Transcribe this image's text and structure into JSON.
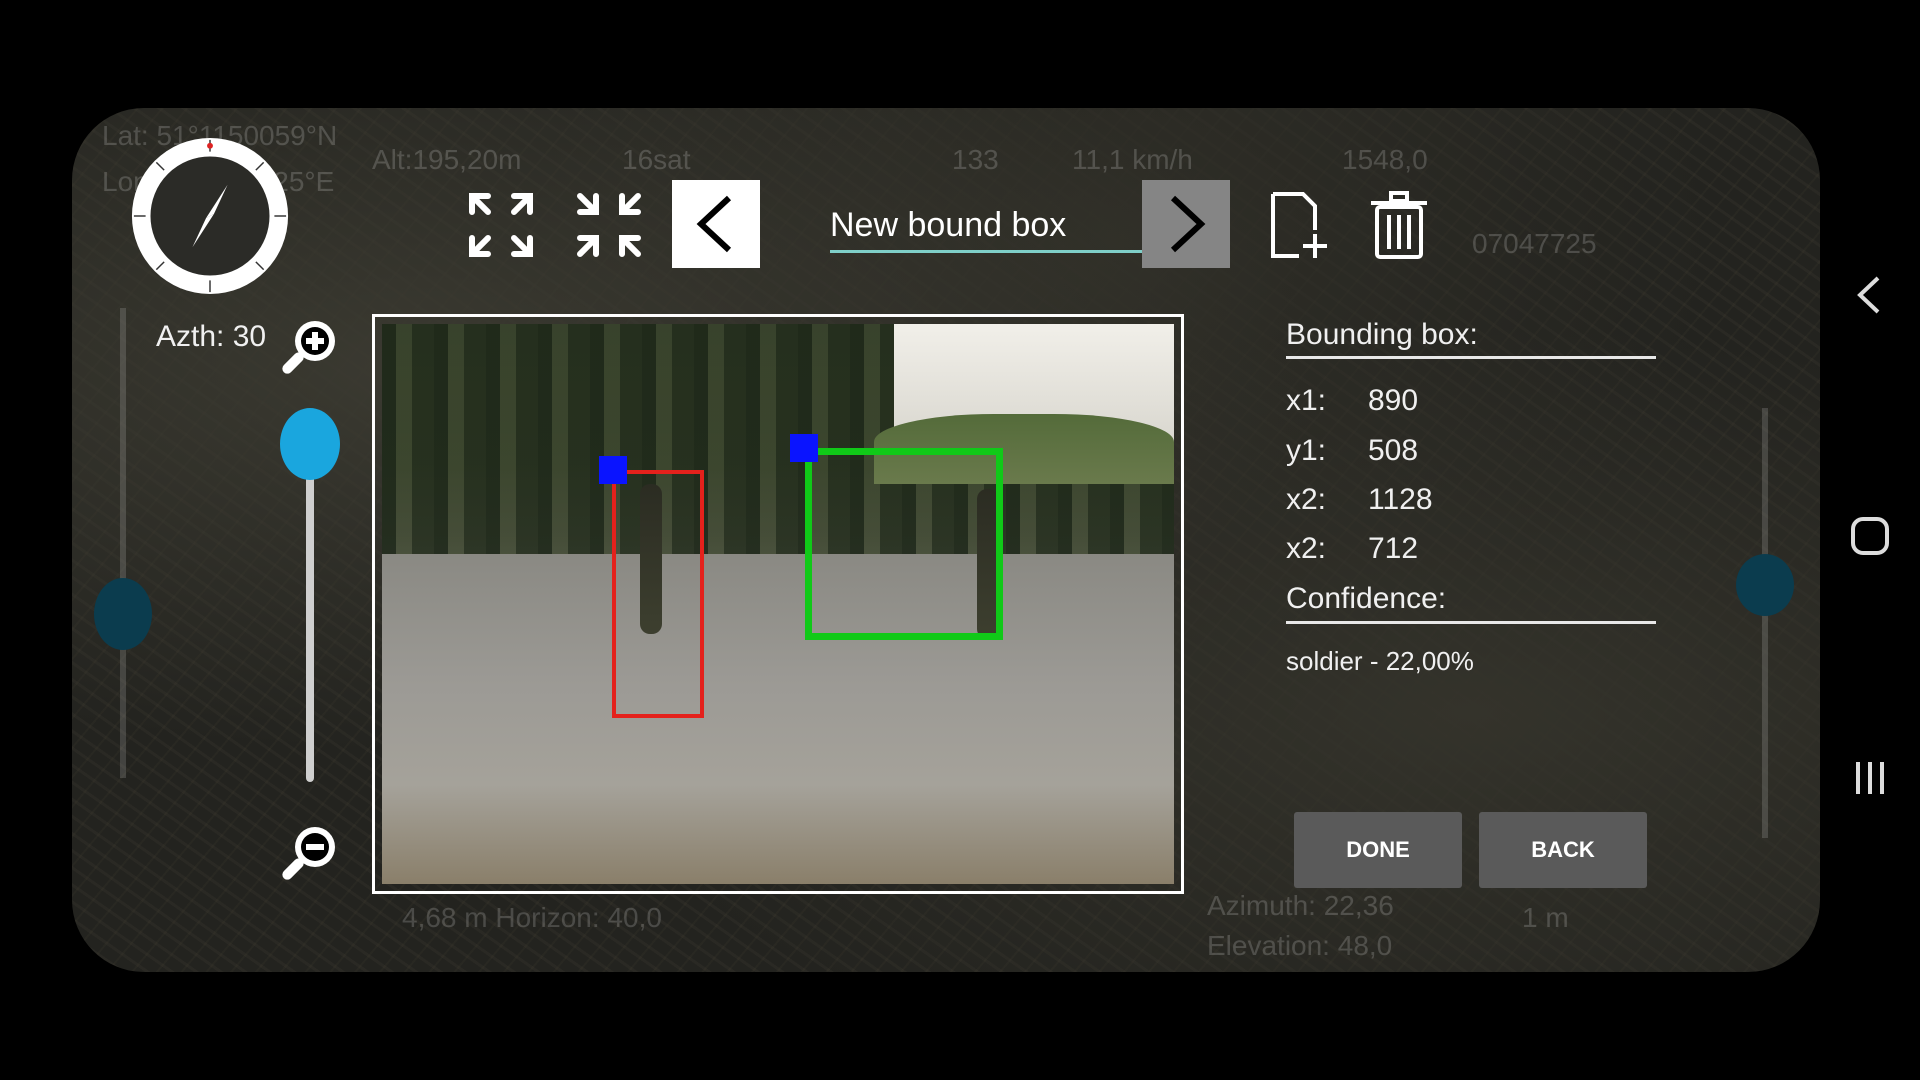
{
  "overlay": {
    "lat": "Lat: 51°1150059°N",
    "lon": "Lon:15.3935725°E",
    "alt": "Alt:195,20m",
    "sat": "16sat",
    "heading": "133",
    "speed": "11,1 km/h",
    "code": "1548,0",
    "coord": "07047725",
    "distance": "4,68 m Horizon: 40,0",
    "azimuth": "Azimuth: 22,36",
    "elevation": "Elevation: 48,0",
    "scale": "1 m"
  },
  "compass": {
    "azimuth_label": "Azth: 30"
  },
  "toolbar": {
    "expand_icon": "expand-icon",
    "collapse_icon": "collapse-icon",
    "prev_icon": "chevron-left-icon",
    "next_icon": "chevron-right-icon",
    "add_icon": "add-file-icon",
    "delete_icon": "trash-icon",
    "title_value": "New bound box"
  },
  "zoom": {
    "level": 0.15
  },
  "panel": {
    "bbox_header": "Bounding box:",
    "rows": [
      {
        "key": "x1:",
        "value": "890"
      },
      {
        "key": "y1:",
        "value": "508"
      },
      {
        "key": "x2:",
        "value": "1128"
      },
      {
        "key": "x2:",
        "value": "712"
      }
    ],
    "confidence_header": "Confidence:",
    "confidence_value": "soldier - 22,00%"
  },
  "actions": {
    "done": "DONE",
    "back": "BACK"
  },
  "colors": {
    "box_red": "#e4211c",
    "box_green": "#10c918",
    "handle": "#0a14ff",
    "accent": "#1aa6de"
  }
}
